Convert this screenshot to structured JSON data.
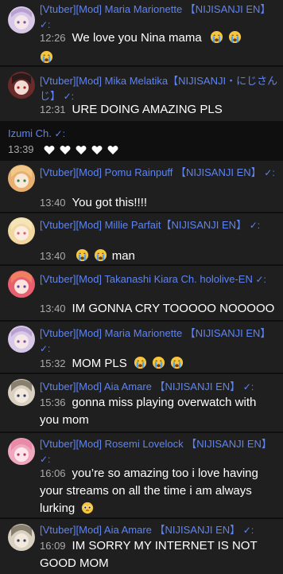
{
  "messages": [
    {
      "author": "[Vtuber][Mod] Maria Marionette 【NIJISANJI EN】",
      "verified": "✓:",
      "time": "12:26",
      "text": "We love you Nina mama",
      "emojis": [
        "crying-face-emoji",
        "crying-face-emoji",
        "crying-face-emoji"
      ],
      "highlighted": true,
      "avatar": "maria-avatar",
      "avatar_color": "#d8c8e8"
    },
    {
      "author": "[Vtuber][Mod] Mika Melatika【NIJISANJI・にじさんじ】",
      "verified": "✓:",
      "time": "12:31",
      "text": "URE DOING AMAZING PLS",
      "emojis": [],
      "highlighted": false,
      "avatar": "mika-avatar",
      "avatar_color": "#6b2b2b"
    },
    {
      "author": "Izumi Ch.",
      "verified": "✓:",
      "time": "13:39",
      "text": "",
      "emojis": [
        "white-heart-emoji",
        "white-heart-emoji",
        "white-heart-emoji",
        "white-heart-emoji",
        "white-heart-emoji"
      ],
      "highlighted": false,
      "avatar": "",
      "avatar_color": ""
    },
    {
      "author": "[Vtuber][Mod] Pomu Rainpuff 【NIJISANJI EN】",
      "verified": "✓:",
      "time": "13:40",
      "text": "You got this!!!!",
      "emojis": [],
      "highlighted": true,
      "avatar": "pomu-avatar",
      "avatar_color": "#e8b070"
    },
    {
      "author": "[Vtuber][Mod] Millie Parfait【NIJISANJI EN】",
      "verified": "✓:",
      "time": "13:40",
      "text": "man",
      "emojis": [
        "crying-face-emoji",
        "crying-face-emoji"
      ],
      "highlighted": true,
      "avatar": "millie-avatar",
      "avatar_color": "#f0d8a0"
    },
    {
      "author": "[Vtuber][Mod] Takanashi Kiara Ch. hololive-EN",
      "verified": "✓:",
      "time": "13:40",
      "text": "IM GONNA CRY TOOOOO NOOOOO",
      "emojis": [],
      "highlighted": true,
      "avatar": "kiara-avatar",
      "avatar_color": "#e86070"
    },
    {
      "author": "[Vtuber][Mod] Maria Marionette 【NIJISANJI EN】",
      "verified": "✓:",
      "time": "15:32",
      "text": "MOM PLS",
      "emojis": [
        "crying-face-emoji",
        "crying-face-emoji",
        "crying-face-emoji"
      ],
      "highlighted": true,
      "avatar": "maria-avatar",
      "avatar_color": "#d8c8e8"
    },
    {
      "author": "[Vtuber][Mod] Aia Amare 【NIJISANJI EN】",
      "verified": "✓:",
      "time": "15:36",
      "text": "gonna miss playing overwatch with you mom",
      "emojis": [],
      "highlighted": true,
      "avatar": "aia-avatar",
      "avatar_color": "#d8d0c0"
    },
    {
      "author": "[Vtuber][Mod] Rosemi Lovelock 【NIJISANJI EN】",
      "verified": "✓:",
      "time": "16:06",
      "text": "you’re so amazing too i love having your streams on all the time i am always lurking",
      "emojis": [
        "pleading-face-emoji"
      ],
      "highlighted": true,
      "avatar": "rosemi-avatar",
      "avatar_color": "#f0a8c0"
    },
    {
      "author": "[Vtuber][Mod] Aia Amare 【NIJISANJI EN】",
      "verified": "✓:",
      "time": "16:09",
      "text": "IM SORRY MY INTERNET IS NOT GOOD MOM",
      "emojis": [],
      "highlighted": true,
      "avatar": "aia-avatar",
      "avatar_color": "#d8d0c0"
    }
  ]
}
